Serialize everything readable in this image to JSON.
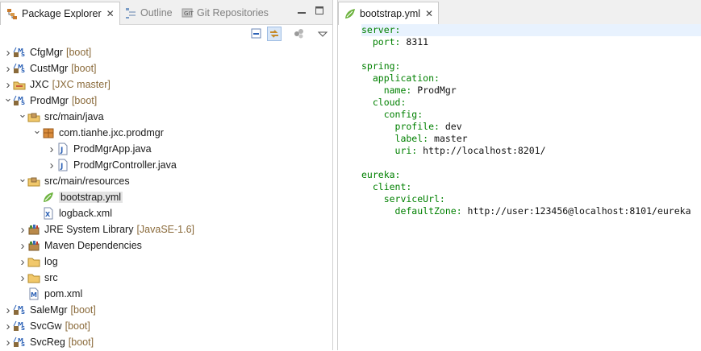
{
  "explorer": {
    "tabs": [
      {
        "label": "Package Explorer",
        "active": true
      },
      {
        "label": "Outline",
        "active": false
      },
      {
        "label": "Git Repositories",
        "active": false
      }
    ],
    "tree": [
      {
        "label": "CfgMgr",
        "decoration": "[boot]",
        "icon": "boot-project-icon",
        "expanded": false
      },
      {
        "label": "CustMgr",
        "decoration": "[boot]",
        "icon": "boot-project-icon",
        "expanded": false
      },
      {
        "label": "JXC",
        "decoration": "[JXC master]",
        "icon": "git-project-icon",
        "expanded": false
      },
      {
        "label": "ProdMgr",
        "decoration": "[boot]",
        "icon": "boot-project-icon",
        "expanded": true
      },
      {
        "label": "src/main/java",
        "decoration": "",
        "icon": "source-folder-icon",
        "expanded": true
      },
      {
        "label": "com.tianhe.jxc.prodmgr",
        "decoration": "",
        "icon": "package-icon",
        "expanded": true
      },
      {
        "label": "ProdMgrApp.java",
        "decoration": "",
        "icon": "java-file-icon",
        "expanded": false
      },
      {
        "label": "ProdMgrController.java",
        "decoration": "",
        "icon": "java-file-icon",
        "expanded": false
      },
      {
        "label": "src/main/resources",
        "decoration": "",
        "icon": "source-folder-icon",
        "expanded": true
      },
      {
        "label": "bootstrap.yml",
        "decoration": "",
        "icon": "yml-file-icon",
        "selected": true
      },
      {
        "label": "logback.xml",
        "decoration": "",
        "icon": "xml-file-icon"
      },
      {
        "label": "JRE System Library",
        "decoration": "[JavaSE-1.6]",
        "icon": "library-icon",
        "expanded": false
      },
      {
        "label": "Maven Dependencies",
        "decoration": "",
        "icon": "library-icon",
        "expanded": false
      },
      {
        "label": "log",
        "decoration": "",
        "icon": "folder-icon",
        "expanded": false
      },
      {
        "label": "src",
        "decoration": "",
        "icon": "folder-icon",
        "expanded": false
      },
      {
        "label": "pom.xml",
        "decoration": "",
        "icon": "pom-file-icon"
      },
      {
        "label": "SaleMgr",
        "decoration": "[boot]",
        "icon": "boot-project-icon",
        "expanded": false
      },
      {
        "label": "SvcGw",
        "decoration": "[boot]",
        "icon": "boot-project-icon",
        "expanded": false
      },
      {
        "label": "SvcReg",
        "decoration": "[boot]",
        "icon": "boot-project-icon",
        "expanded": false
      }
    ]
  },
  "editor": {
    "tab_label": "bootstrap.yml",
    "lines": [
      {
        "key": "server:",
        "val": ""
      },
      {
        "key": "  port:",
        "val": " 8311"
      },
      {
        "key": "",
        "val": ""
      },
      {
        "key": "spring:",
        "val": ""
      },
      {
        "key": "  application:",
        "val": ""
      },
      {
        "key": "    name:",
        "val": " ProdMgr"
      },
      {
        "key": "  cloud:",
        "val": ""
      },
      {
        "key": "    config:",
        "val": ""
      },
      {
        "key": "      profile:",
        "val": " dev"
      },
      {
        "key": "      label:",
        "val": " master"
      },
      {
        "key": "      uri:",
        "val": " http://localhost:8201/"
      },
      {
        "key": "",
        "val": ""
      },
      {
        "key": "eureka:",
        "val": ""
      },
      {
        "key": "  client:",
        "val": ""
      },
      {
        "key": "    serviceUrl:",
        "val": ""
      },
      {
        "key": "      defaultZone:",
        "val": " http://user:123456@localhost:8101/eureka"
      }
    ]
  }
}
